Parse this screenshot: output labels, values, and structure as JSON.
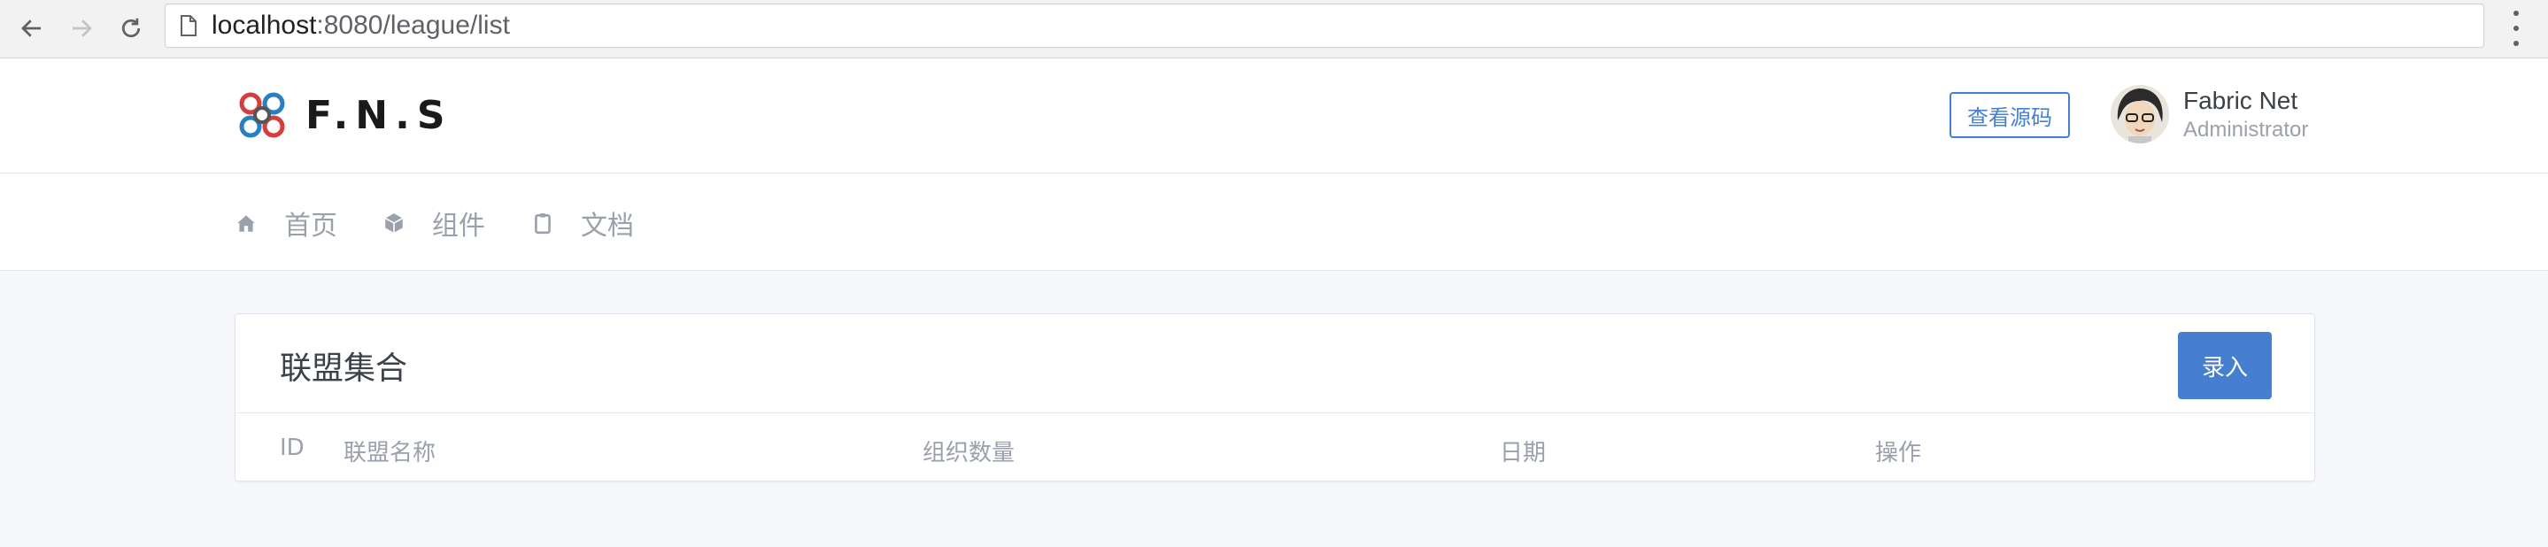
{
  "browser": {
    "url_host": "localhost",
    "url_rest": ":8080/league/list"
  },
  "header": {
    "logo_text": "F.N.S",
    "source_button": "查看源码",
    "user_name": "Fabric Net",
    "user_role": "Administrator"
  },
  "nav": {
    "tabs": [
      {
        "label": "首页",
        "icon": "home-icon"
      },
      {
        "label": "组件",
        "icon": "cube-icon"
      },
      {
        "label": "文档",
        "icon": "clipboard-icon"
      }
    ]
  },
  "card": {
    "title": "联盟集合",
    "entry_button": "录入",
    "columns": [
      "ID",
      "联盟名称",
      "组织数量",
      "日期",
      "操作"
    ]
  },
  "colors": {
    "accent": "#467fcf",
    "muted_text": "#9aa0ac",
    "page_bg": "#f5f7fb"
  }
}
